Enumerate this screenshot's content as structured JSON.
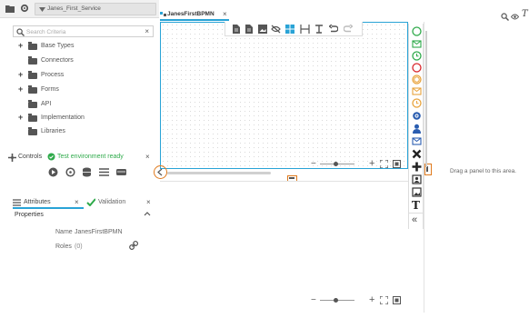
{
  "left_tabbar": {
    "service_tab": "Janes_First_Service"
  },
  "search": {
    "placeholder": "Search Criteria"
  },
  "tree": [
    {
      "label": "Base Types",
      "expandable": true
    },
    {
      "label": "Connectors",
      "expandable": false
    },
    {
      "label": "Process",
      "expandable": true
    },
    {
      "label": "Forms",
      "expandable": true
    },
    {
      "label": "API",
      "expandable": false
    },
    {
      "label": "Implementation",
      "expandable": true
    },
    {
      "label": "Libraries",
      "expandable": false
    }
  ],
  "controls": {
    "label": "Controls",
    "status": "Test environment ready",
    "status_color": "#2eaa4a"
  },
  "attributes": {
    "tab_attributes": "Attributes",
    "tab_validation": "Validation",
    "section": "Properties",
    "name_label": "Name",
    "name_value": "JanesFirstBPMN",
    "roles_label": "Roles",
    "roles_value": "(0)"
  },
  "canvas": {
    "tab_label": "JanesFirstBPMN"
  },
  "right_panel": {
    "drop_hint": "Drag a panel to this area."
  },
  "colors": {
    "accent": "#29a3d6",
    "palette_green": "#2eaa4a",
    "palette_red": "#d9262b",
    "palette_orange": "#e8a33c",
    "palette_blue": "#2a5db0",
    "highlight_orange": "#e07b1e"
  }
}
